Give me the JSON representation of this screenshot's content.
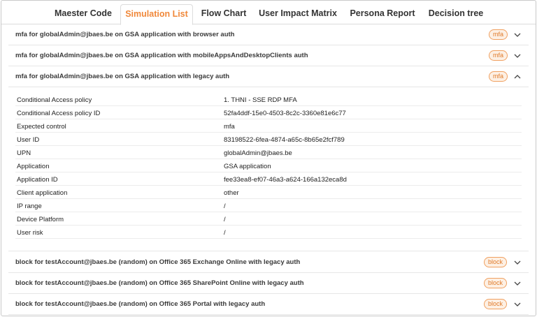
{
  "tabs": [
    {
      "label": "Maester Code",
      "active": false
    },
    {
      "label": "Simulation List",
      "active": true
    },
    {
      "label": "Flow Chart",
      "active": false
    },
    {
      "label": "User Impact Matrix",
      "active": false
    },
    {
      "label": "Persona Report",
      "active": false
    },
    {
      "label": "Decision tree",
      "active": false
    }
  ],
  "simulations": [
    {
      "title": "mfa for globalAdmin@jbaes.be on GSA application with browser auth",
      "badge": "mfa",
      "expanded": false
    },
    {
      "title": "mfa for globalAdmin@jbaes.be on GSA application with mobileAppsAndDesktopClients auth",
      "badge": "mfa",
      "expanded": false
    },
    {
      "title": "mfa for globalAdmin@jbaes.be on GSA application with legacy auth",
      "badge": "mfa",
      "expanded": true
    },
    {
      "title": "block for testAccount@jbaes.be (random) on Office 365 Exchange Online with legacy auth",
      "badge": "block",
      "expanded": false
    },
    {
      "title": "block for testAccount@jbaes.be (random) on Office 365 SharePoint Online with legacy auth",
      "badge": "block",
      "expanded": false
    },
    {
      "title": "block for testAccount@jbaes.be (random) on Office 365 Portal with legacy auth",
      "badge": "block",
      "expanded": false
    }
  ],
  "details": [
    {
      "key": "Conditional Access policy",
      "value": "1. THNI - SSE RDP MFA"
    },
    {
      "key": "Conditional Access policy ID",
      "value": "52fa4ddf-15e0-4503-8c2c-3360e81e6c77"
    },
    {
      "key": "Expected control",
      "value": "mfa"
    },
    {
      "key": "User ID",
      "value": "83198522-6fea-4874-a65c-8b65e2fcf789"
    },
    {
      "key": "UPN",
      "value": "globalAdmin@jbaes.be"
    },
    {
      "key": "Application",
      "value": "GSA application"
    },
    {
      "key": "Application ID",
      "value": "fee33ea8-ef07-46a3-a624-166a132eca8d"
    },
    {
      "key": "Client application",
      "value": "other"
    },
    {
      "key": "IP range",
      "value": "/"
    },
    {
      "key": "Device Platform",
      "value": "/"
    },
    {
      "key": "User risk",
      "value": "/"
    }
  ],
  "colors": {
    "accent": "#f0883a",
    "badge_border": "#f0a060",
    "badge_bg": "#fdf0e4"
  },
  "icons": {
    "collapsed": "chevron-down-icon",
    "expanded": "chevron-up-icon"
  }
}
